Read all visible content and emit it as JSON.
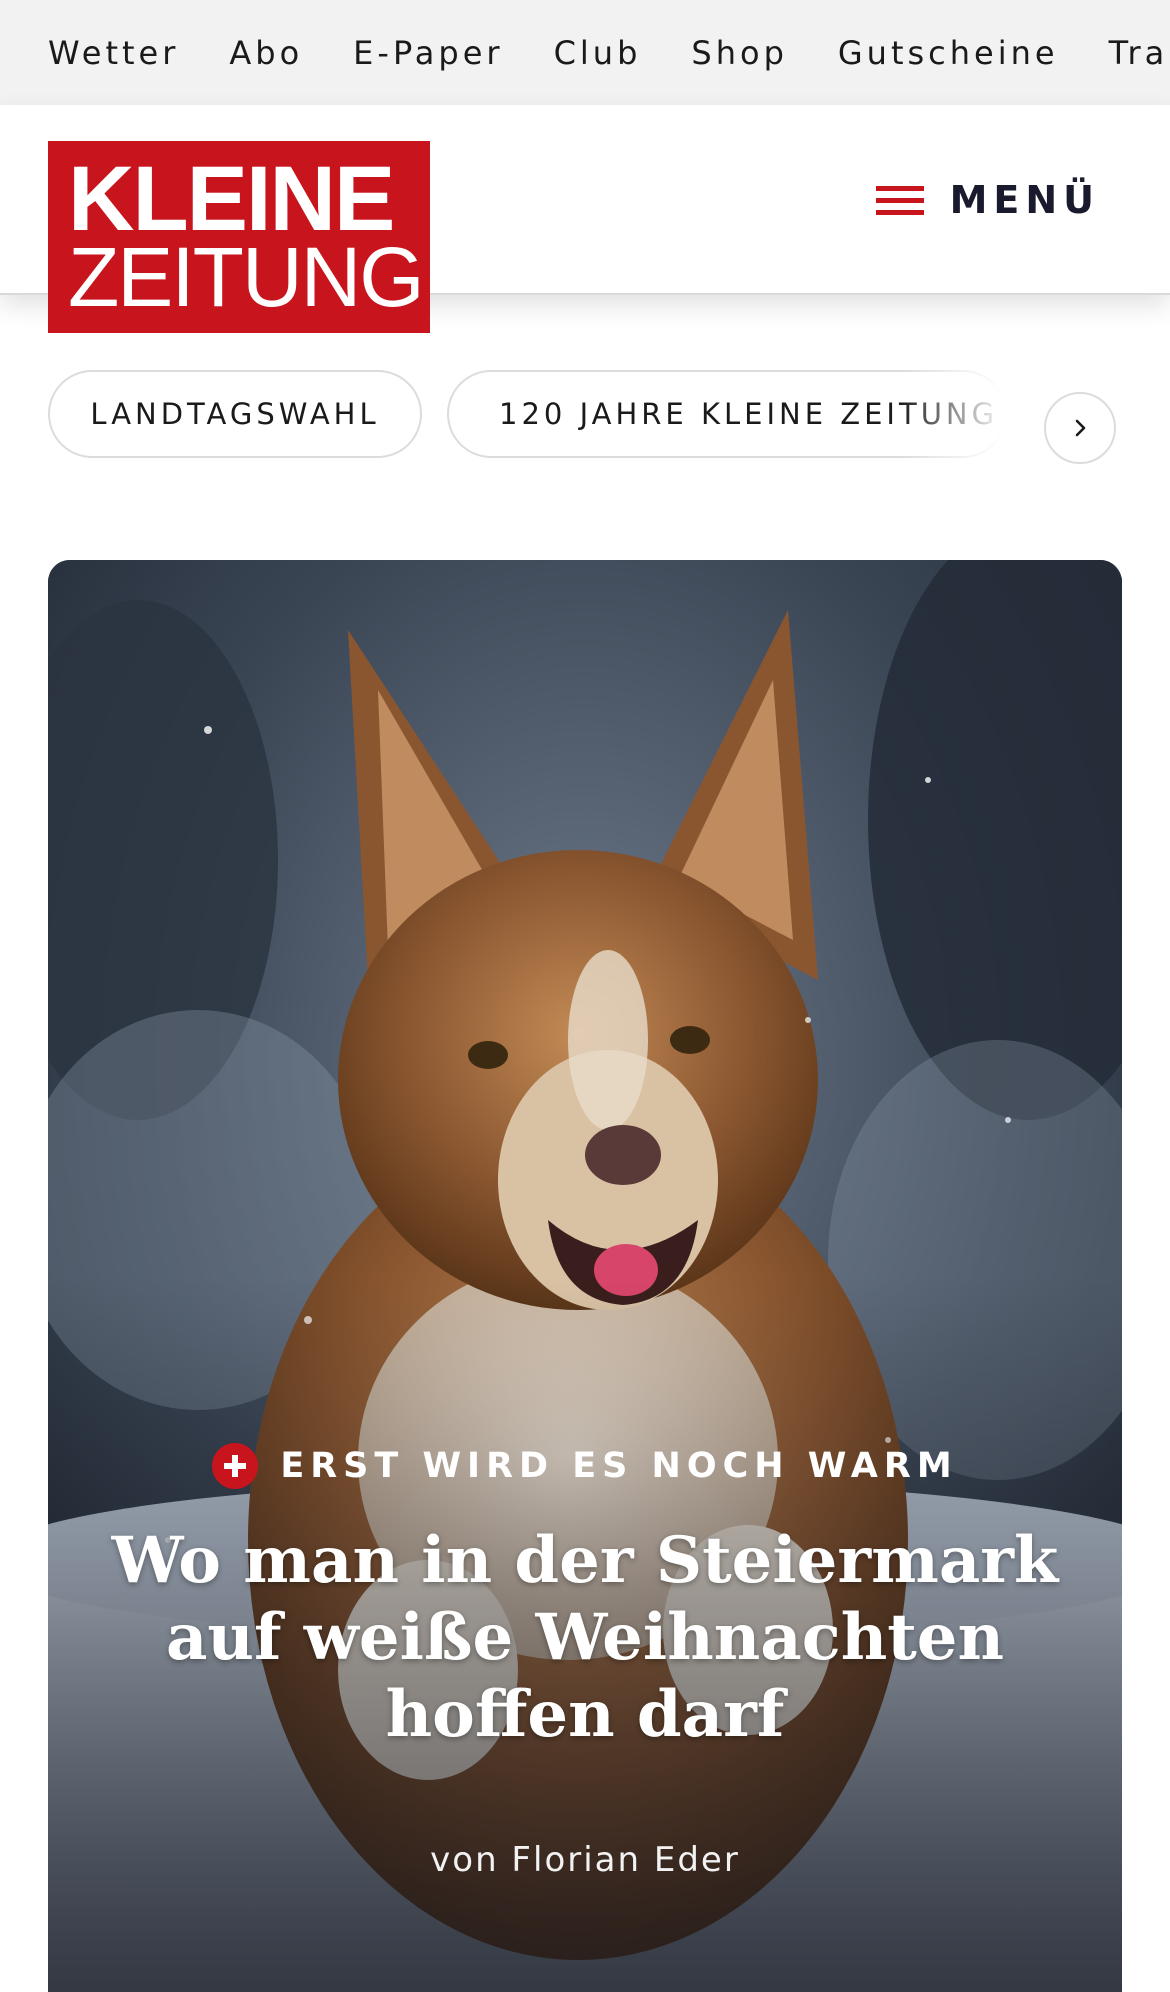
{
  "service_nav": {
    "items": [
      "Wetter",
      "Abo",
      "E-Paper",
      "Club",
      "Shop",
      "Gutscheine",
      "Trauerportal"
    ]
  },
  "header": {
    "logo_line1": "KLEINE",
    "logo_line2": "ZEITUNG",
    "menu_label": "MENÜ",
    "brand_color": "#c8141c"
  },
  "topics": {
    "chips": [
      "LANDTAGSWAHL",
      "120 JAHRE KLEINE ZEITUNG"
    ],
    "next_icon": "chevron-right-icon"
  },
  "hero": {
    "kicker": "ERST WIRD ES NOCH WARM",
    "kicker_icon": "plus-icon",
    "headline": "Wo man in der Steiermark auf weiße Weihnachten hoffen darf",
    "byline": "von Florian Eder"
  }
}
